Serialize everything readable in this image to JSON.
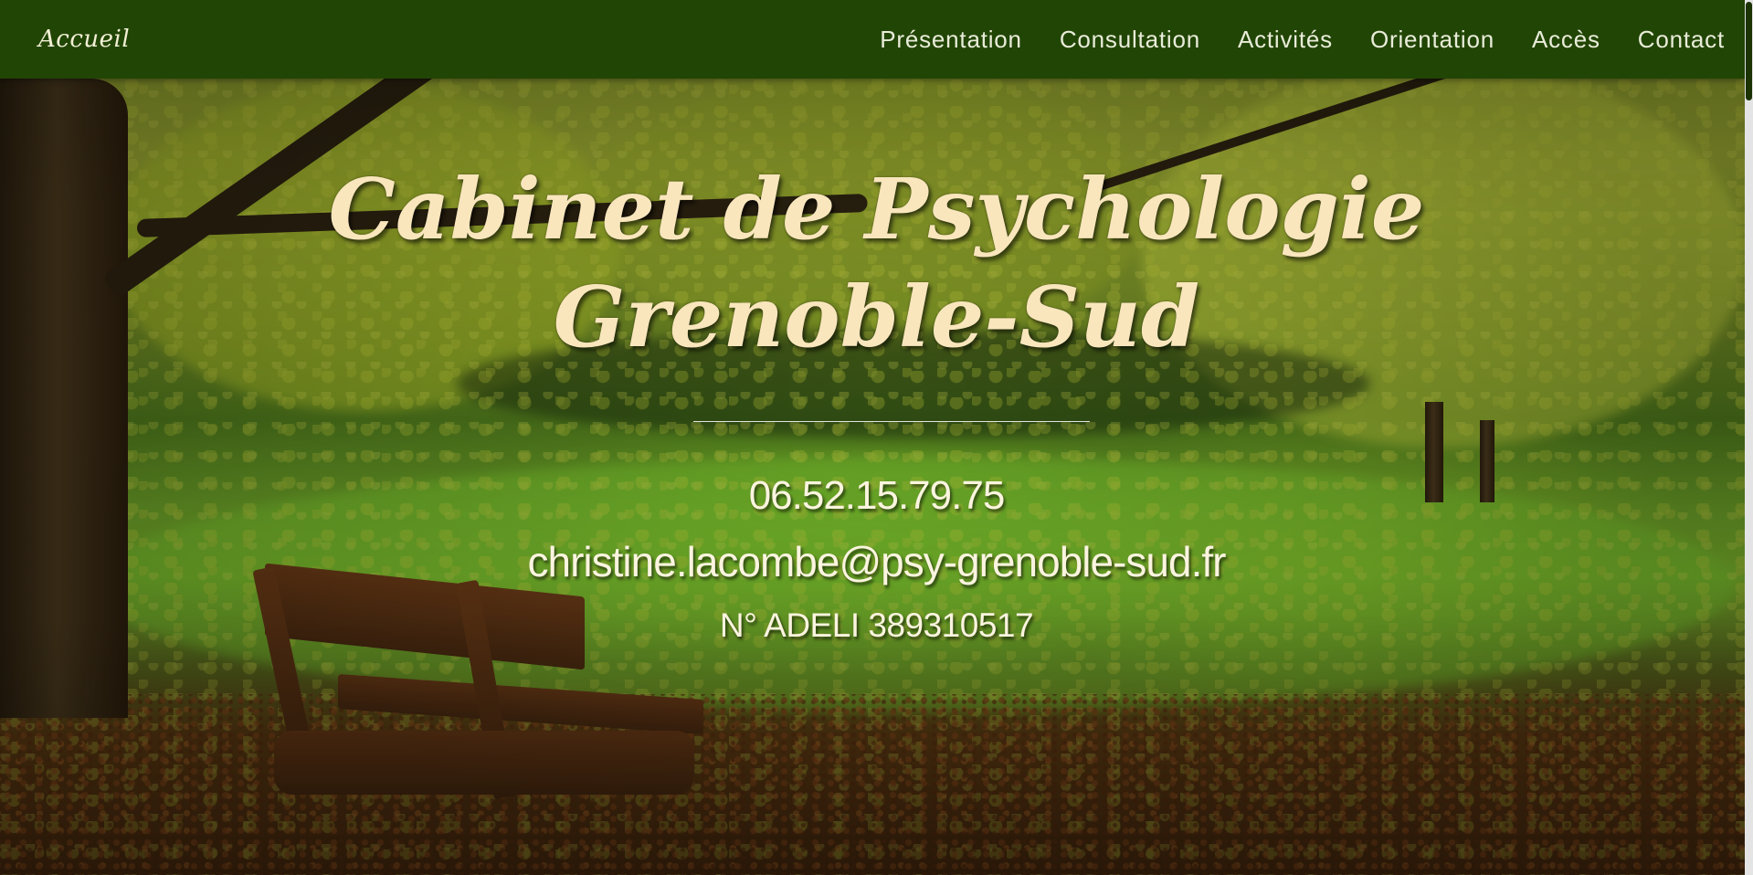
{
  "nav": {
    "brand": "Accueil",
    "links": [
      "Présentation",
      "Consultation",
      "Activités",
      "Orientation",
      "Accès",
      "Contact"
    ]
  },
  "hero": {
    "title_line1": "Cabinet de Psychologie",
    "title_line2": "Grenoble-Sud",
    "phone": "06.52.15.79.75",
    "email": "christine.lacombe@psy-grenoble-sud.fr",
    "adeli": "N° ADELI 389310517"
  },
  "colors": {
    "nav_background": "#214505",
    "title_text": "#f9e6bd",
    "body_text": "#fbf4df"
  }
}
